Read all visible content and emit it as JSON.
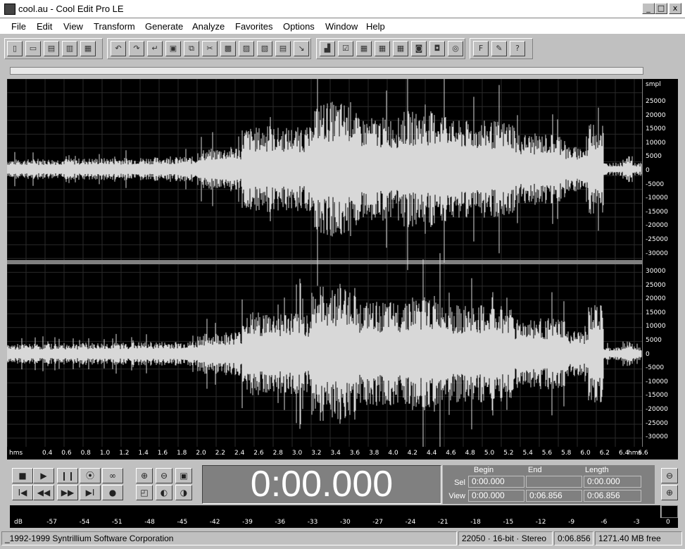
{
  "window": {
    "title": "cool.au - Cool Edit Pro LE",
    "min": "_",
    "max": "□",
    "close": "x"
  },
  "menu": [
    "File",
    "Edit",
    "View",
    "Transform",
    "Generate",
    "Analyze",
    "Favorites",
    "Options",
    "Window",
    "Help"
  ],
  "toolbar": {
    "icons": [
      "new-icon",
      "open-icon",
      "save-icon",
      "save-as-icon",
      "close-file-icon",
      "undo-icon",
      "redo-icon",
      "repeat-icon",
      "copy-to-new-icon",
      "copy-icon",
      "cut-icon",
      "paste-icon",
      "paste-new-icon",
      "mix-paste-icon",
      "trim-icon",
      "snap-icon",
      "spectral-view-icon",
      "checkbox-icon",
      "grid-a-icon",
      "grid-b-icon",
      "grid-c-icon",
      "cd-icon",
      "doc-icon",
      "disc-icon",
      "f-icon",
      "script-icon",
      "help-icon"
    ],
    "help_label": "?",
    "f_label": "F"
  },
  "amplitude": {
    "unit": "smpl",
    "top_labels": [
      "25000",
      "20000",
      "15000",
      "10000",
      "5000",
      "0",
      "-5000",
      "-10000",
      "-15000",
      "-20000",
      "-25000",
      "-30000"
    ],
    "bottom_labels": [
      "30000",
      "25000",
      "20000",
      "15000",
      "10000",
      "5000",
      "0",
      "-5000",
      "-10000",
      "-15000",
      "-20000",
      "-25000",
      "-30000"
    ]
  },
  "time_ruler": {
    "unit": "hms",
    "labels": [
      "0.4",
      "0.6",
      "0.8",
      "1.0",
      "1.2",
      "1.4",
      "1.6",
      "1.8",
      "2.0",
      "2.2",
      "2.4",
      "2.6",
      "2.8",
      "3.0",
      "3.2",
      "3.4",
      "3.6",
      "3.8",
      "4.0",
      "4.2",
      "4.4",
      "4.6",
      "4.8",
      "5.0",
      "5.2",
      "5.4",
      "5.6",
      "5.8",
      "6.0",
      "6.2",
      "6.4",
      "6.6"
    ]
  },
  "transport": {
    "stop": "■",
    "play": "▶",
    "pause": "❙❙",
    "play_to_end": "⦿",
    "loop": "∞",
    "go_start": "I◀",
    "rewind": "◀◀",
    "ffwd": "▶▶",
    "go_end": "▶I",
    "record": "●"
  },
  "zoom": {
    "in_h": "⊕",
    "out_h": "⊖",
    "full": "▣",
    "sel": "◰",
    "in_left": "◐",
    "in_right": "◑",
    "out_v": "⊖",
    "in_v": "⊕"
  },
  "time_display": "0:00.000",
  "selection": {
    "head_begin": "Begin",
    "head_end": "End",
    "head_length": "Length",
    "sel_label": "Sel",
    "view_label": "View",
    "sel_begin": "0:00.000",
    "sel_end": "",
    "sel_length": "0:00.000",
    "view_begin": "0:00.000",
    "view_end": "0:06.856",
    "view_length": "0:06.856"
  },
  "meter": {
    "labels": [
      "dB",
      "-57",
      "-54",
      "-51",
      "-48",
      "-45",
      "-42",
      "-39",
      "-36",
      "-33",
      "-30",
      "-27",
      "-24",
      "-21",
      "-18",
      "-15",
      "-12",
      "-9",
      "-6",
      "-3",
      "0"
    ]
  },
  "status": {
    "copyright": "_1992-1999 Syntrillium Software Corporation",
    "format": "22050 · 16-bit · Stereo",
    "length": "0:06.856",
    "free": "1271.40 MB free"
  }
}
